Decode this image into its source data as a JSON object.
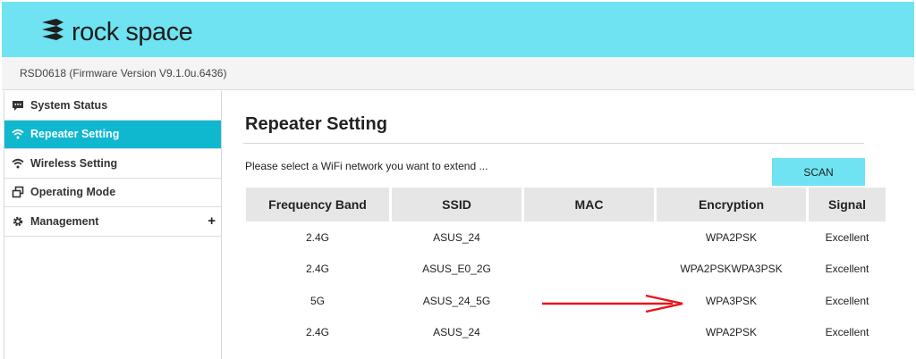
{
  "header": {
    "brand": "rock space",
    "logo_icon": "rockspace-logo-icon",
    "background": "#6fe3f1"
  },
  "model_info": "RSD0618 (Firmware Version V9.1.0u.6436)",
  "sidebar": {
    "items": [
      {
        "label": "System Status",
        "icon": "chat-bubble-icon",
        "active": false
      },
      {
        "label": "Repeater Setting",
        "icon": "wifi-icon",
        "active": true
      },
      {
        "label": "Wireless Setting",
        "icon": "wifi-icon",
        "active": false
      },
      {
        "label": "Operating Mode",
        "icon": "windows-icon",
        "active": false
      },
      {
        "label": "Management",
        "icon": "gear-icon",
        "active": false,
        "expand": "+"
      }
    ],
    "active_color": "#0fb8cf"
  },
  "main": {
    "title": "Repeater Setting",
    "instruction": "Please select a WiFi network you want to extend ...",
    "scan_label": "SCAN",
    "table": {
      "headers": [
        "Frequency Band",
        "SSID",
        "MAC",
        "Encryption",
        "Signal"
      ],
      "rows": [
        [
          "2.4G",
          "ASUS_24",
          "",
          "WPA2PSK",
          "Excellent"
        ],
        [
          "2.4G",
          "ASUS_E0_2G",
          "",
          "WPA2PSKWPA3PSK",
          "Excellent"
        ],
        [
          "5G",
          "ASUS_24_5G",
          "",
          "WPA3PSK",
          "Excellent"
        ],
        [
          "2.4G",
          "ASUS_24",
          "",
          "WPA2PSK",
          "Excellent"
        ]
      ]
    },
    "annotation": {
      "icon": "red-arrow-annotation",
      "color": "#e8141c"
    }
  }
}
